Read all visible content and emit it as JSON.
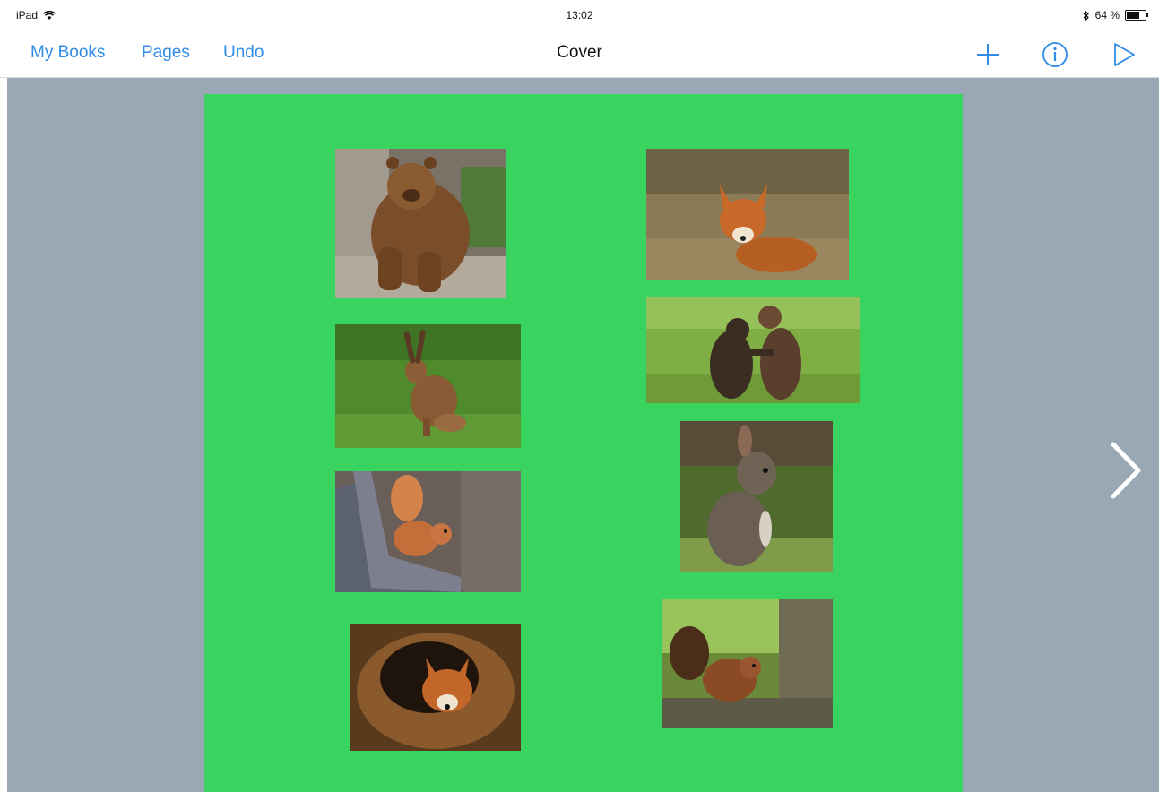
{
  "status_bar": {
    "device": "iPad",
    "time": "13:02",
    "battery": "64 %"
  },
  "nav": {
    "my_books": "My Books",
    "pages": "Pages",
    "undo": "Undo",
    "title": "Cover"
  },
  "colors": {
    "accent": "#2f8be6",
    "page_background": "#39d35f",
    "workspace_background": "#9aa7b5"
  },
  "icons": {
    "add": "plus-icon",
    "info": "info-icon",
    "play": "play-icon",
    "next": "chevron-right-icon"
  },
  "page": {
    "photos": [
      {
        "subject": "bear"
      },
      {
        "subject": "fox"
      },
      {
        "subject": "hare"
      },
      {
        "subject": "bear-cubs"
      },
      {
        "subject": "squirrel"
      },
      {
        "subject": "rabbit"
      },
      {
        "subject": "fox-in-log"
      },
      {
        "subject": "squirrel-in-tree"
      }
    ]
  }
}
